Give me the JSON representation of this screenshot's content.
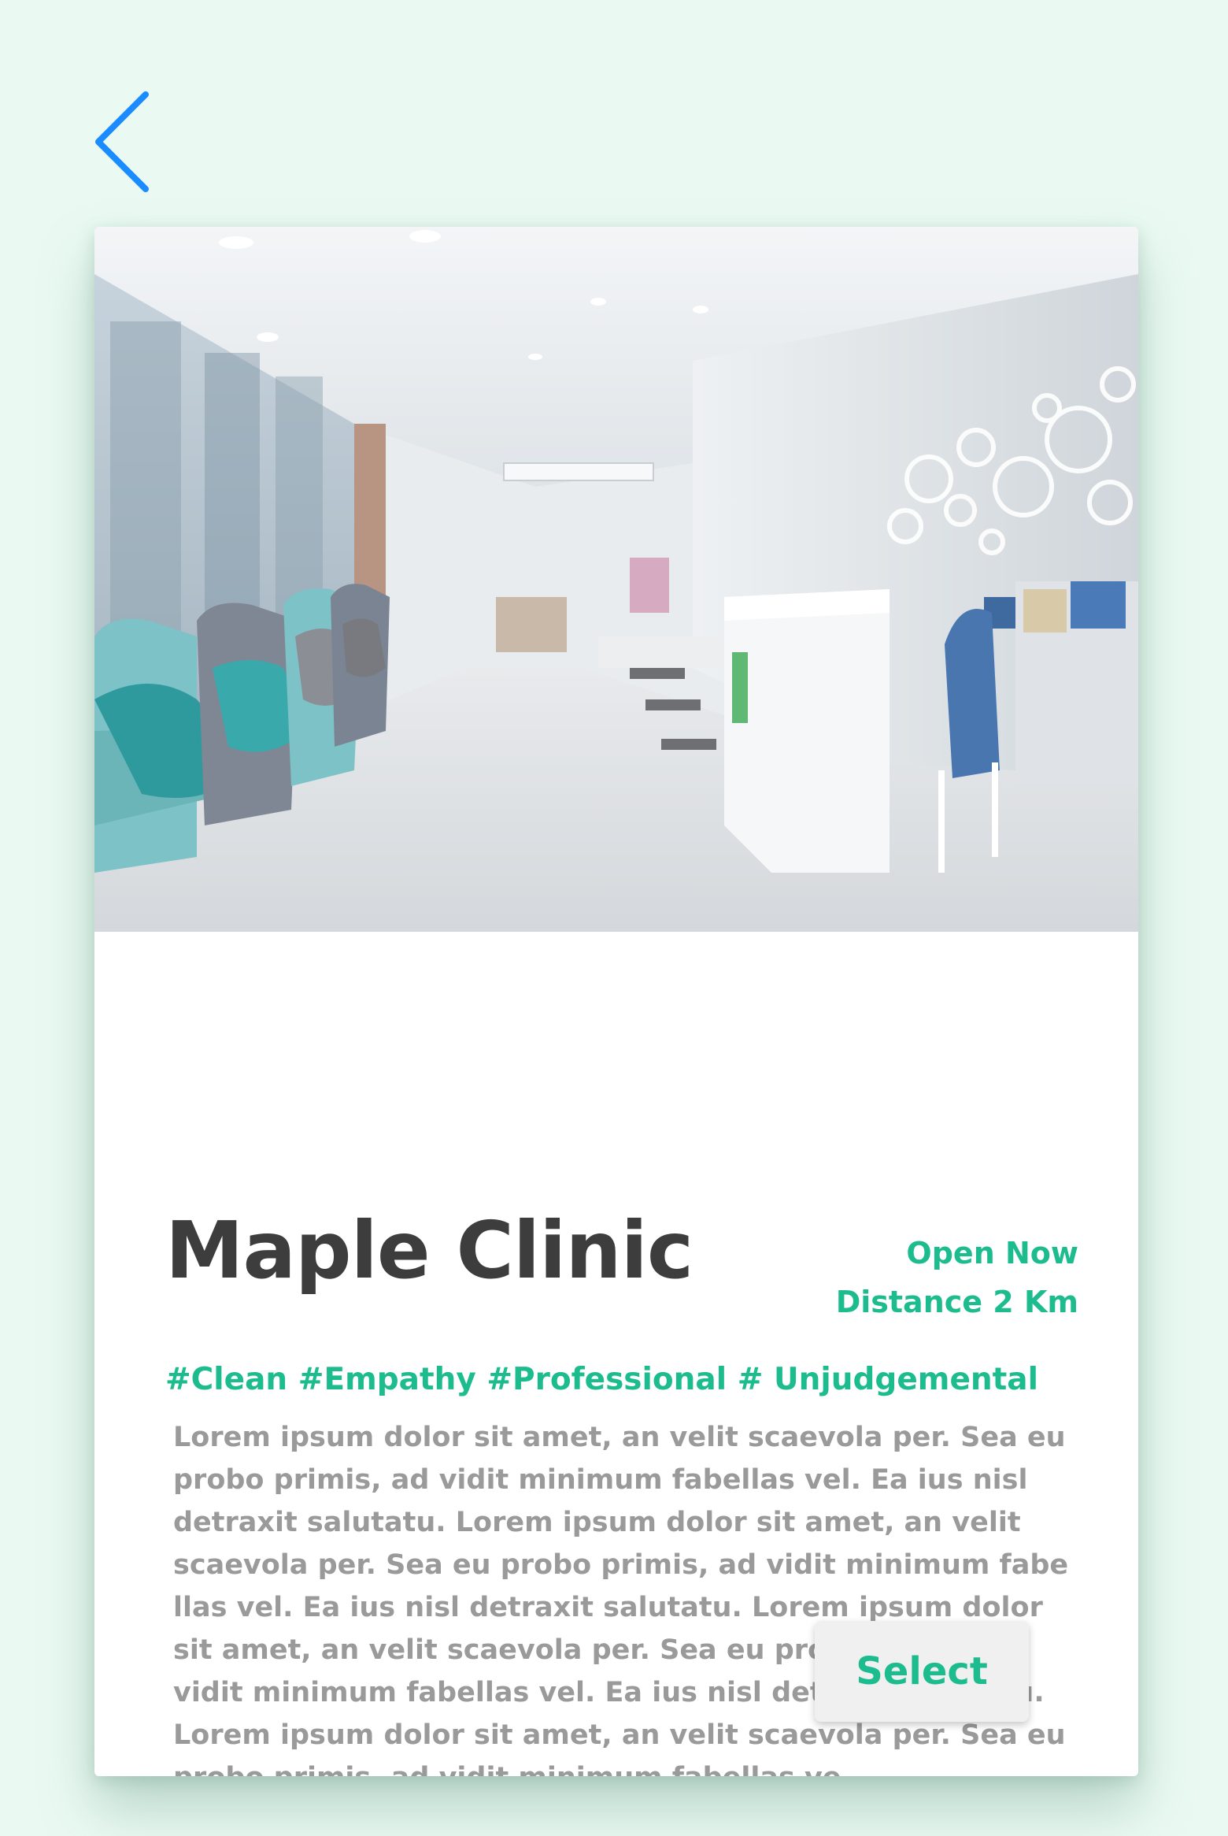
{
  "header": {
    "back_icon": "chevron-left-icon"
  },
  "clinic": {
    "name": "Maple Clinic",
    "status": "Open Now",
    "distance": "Distance 2 Km",
    "tags": "#Clean #Empathy #Professional # Unjudgemental",
    "description": "Lorem ipsum dolor sit amet, an velit scaevola per. Sea eu probo primis, ad vidit minimum fabellas vel. Ea ius nisl detraxit salutatu. Lorem ipsum dolor sit amet, an velit scaevola per. Sea eu probo primis, ad vidit minimum fabe llas vel. Ea ius nisl detraxit salutatu. Lorem ipsum dolor sit amet, an velit scaevola per. Sea eu probo primis, ad vidit minimum fabellas vel. Ea ius nisl detraxit salutatu. Lorem ipsum dolor sit amet, an velit scaevola per. Sea eu probo primis, ad vidit minimum fabellas ve."
  },
  "actions": {
    "select_label": "Select"
  },
  "colors": {
    "background": "#eafaf2",
    "accent": "#1dbc8e",
    "back_arrow": "#1a8cff",
    "title": "#3d3d3d",
    "body_text": "#9a9a9a"
  }
}
